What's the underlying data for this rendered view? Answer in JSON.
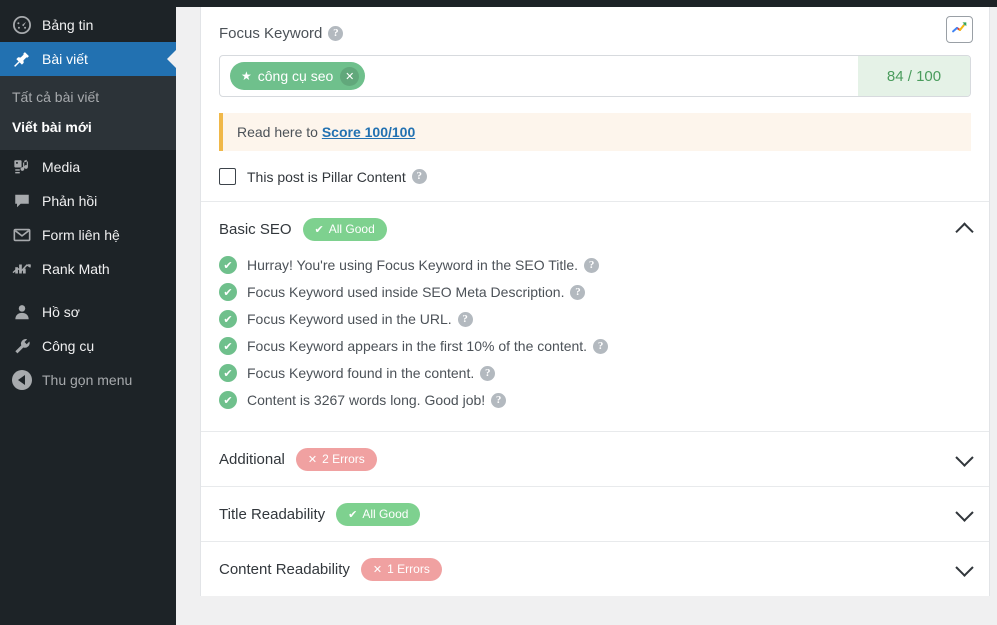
{
  "sidebar": {
    "items": [
      {
        "label": "Bảng tin",
        "icon": "dashboard-icon",
        "current": false
      },
      {
        "label": "Bài viết",
        "icon": "pin-icon",
        "current": true
      },
      {
        "label": "Media",
        "icon": "media-icon",
        "current": false
      },
      {
        "label": "Phản hồi",
        "icon": "comment-icon",
        "current": false
      },
      {
        "label": "Form liên hệ",
        "icon": "envelope-icon",
        "current": false
      },
      {
        "label": "Rank Math",
        "icon": "rank-math-icon",
        "current": false
      },
      {
        "label": "Hồ sơ",
        "icon": "user-icon",
        "current": false
      },
      {
        "label": "Công cụ",
        "icon": "wrench-icon",
        "current": false
      }
    ],
    "submenu": [
      {
        "label": "Tất cả bài viết",
        "active": false
      },
      {
        "label": "Viết bài mới",
        "active": true
      }
    ],
    "collapse": {
      "label": "Thu gọn menu",
      "icon": "collapse-left-icon"
    }
  },
  "focus_keyword": {
    "title": "Focus Keyword",
    "help": "?",
    "trends_button_icon": "google-trends-icon",
    "tag": {
      "star": "★",
      "text": "công cụ seo",
      "remove": "✕"
    },
    "score": "84 / 100",
    "notice": {
      "prefix": "Read here to ",
      "link": "Score 100/100"
    },
    "pillar": {
      "label": "This post is Pillar Content",
      "checked": false,
      "help": "?"
    }
  },
  "sections": [
    {
      "title": "Basic SEO",
      "badge": {
        "text": "All Good",
        "type": "good",
        "icon": "✔"
      },
      "expanded": true,
      "chevron": "chevron-up-icon",
      "items": [
        {
          "status": "good",
          "text": "Hurray! You're using Focus Keyword in the SEO Title.",
          "help": "?"
        },
        {
          "status": "good",
          "text": "Focus Keyword used inside SEO Meta Description.",
          "help": "?"
        },
        {
          "status": "good",
          "text": "Focus Keyword used in the URL.",
          "help": "?"
        },
        {
          "status": "good",
          "text": "Focus Keyword appears in the first 10% of the content.",
          "help": "?"
        },
        {
          "status": "good",
          "text": "Focus Keyword found in the content.",
          "help": "?"
        },
        {
          "status": "good",
          "text": "Content is 3267 words long. Good job!",
          "help": "?"
        }
      ]
    },
    {
      "title": "Additional",
      "badge": {
        "text": "2 Errors",
        "type": "err",
        "icon": "✕"
      },
      "expanded": false,
      "chevron": "chevron-down-icon",
      "items": []
    },
    {
      "title": "Title Readability",
      "badge": {
        "text": "All Good",
        "type": "good",
        "icon": "✔"
      },
      "expanded": false,
      "chevron": "chevron-down-icon",
      "items": []
    },
    {
      "title": "Content Readability",
      "badge": {
        "text": "1 Errors",
        "type": "err",
        "icon": "✕"
      },
      "expanded": false,
      "chevron": "chevron-down-icon",
      "items": []
    }
  ],
  "colors": {
    "sidebar_bg": "#1d2327",
    "sidebar_current": "#2271b1",
    "green": "#6fc08c",
    "badge_green": "#7ed18f",
    "badge_red": "#f0a1a1",
    "notice_bg": "#fdf5ec",
    "notice_border": "#f0b849",
    "link": "#2271b1",
    "score_bg": "#e5f2e7",
    "score_text": "#4a9c5d"
  }
}
